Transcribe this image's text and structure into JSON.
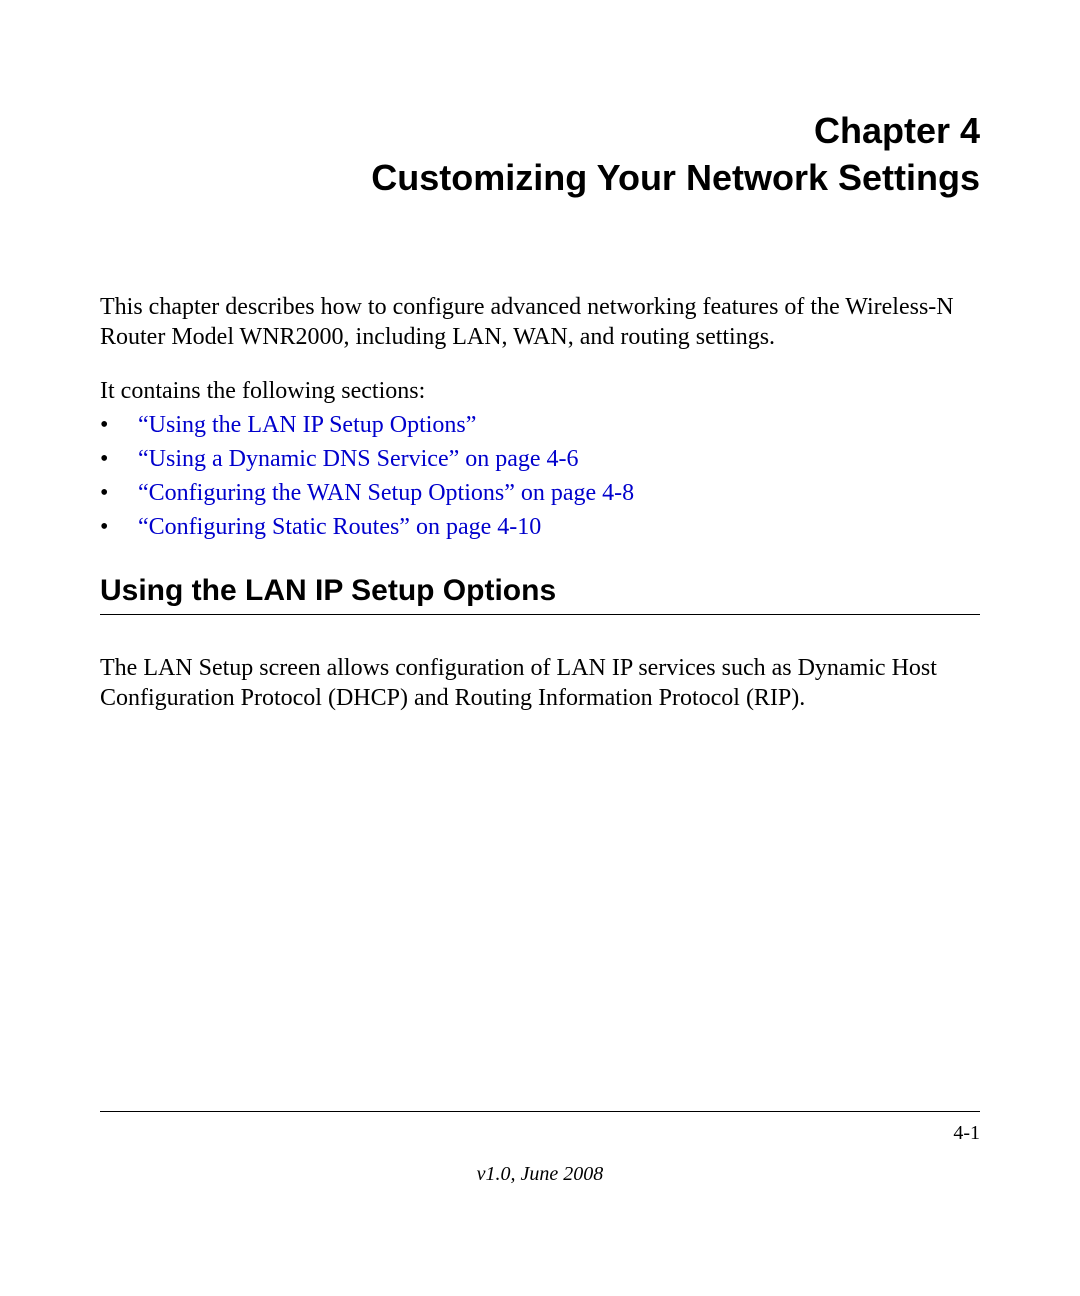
{
  "chapter": {
    "line1": "Chapter 4",
    "line2": "Customizing Your Network Settings"
  },
  "intro": "This chapter describes how to configure advanced networking features of the Wireless-N Router Model WNR2000, including LAN, WAN, and routing settings.",
  "contains_label": "It contains the following sections:",
  "toc": [
    {
      "text": "“Using the LAN IP Setup Options”"
    },
    {
      "text": "“Using a Dynamic DNS Service” on page 4-6"
    },
    {
      "text": "“Configuring the WAN Setup Options” on page 4-8"
    },
    {
      "text": "“Configuring Static Routes” on page 4-10"
    }
  ],
  "section": {
    "heading": "Using the LAN IP Setup Options",
    "para": "The LAN Setup screen allows configuration of LAN IP services such as Dynamic Host Configuration Protocol (DHCP) and Routing Information Protocol (RIP)."
  },
  "footer": {
    "page_num": "4-1",
    "version": "v1.0, June 2008"
  }
}
